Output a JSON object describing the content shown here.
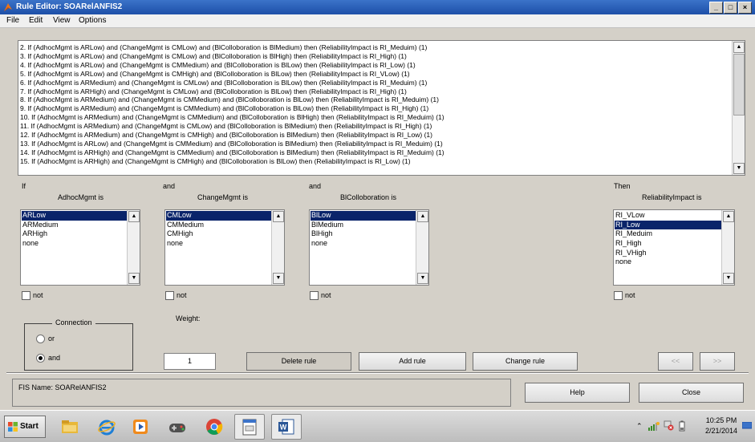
{
  "window": {
    "title": "Rule Editor: SOARelANFIS2"
  },
  "menu": [
    "File",
    "Edit",
    "View",
    "Options"
  ],
  "rules": [
    "2. If (AdhocMgmt is ARLow) and (ChangeMgmt is CMLow) and (BlColloboration is BlMedium) then (ReliabilityImpact is RI_Meduim) (1)",
    "3. If (AdhocMgmt is ARLow) and (ChangeMgmt is CMLow) and (BlColloboration is BlHigh) then (ReliabilityImpact is RI_High) (1)",
    "4. If (AdhocMgmt is ARLow) and (ChangeMgmt is CMMedium) and (BlColloboration is BlLow) then (ReliabilityImpact is RI_Low) (1)",
    "5. If (AdhocMgmt is ARLow) and (ChangeMgmt is CMHigh) and (BlColloboration is BlLow) then (ReliabilityImpact is RI_VLow) (1)",
    "6. If (AdhocMgmt is ARMedium) and (ChangeMgmt is CMLow) and (BlColloboration is BlLow) then (ReliabilityImpact is RI_Meduim) (1)",
    "7. If (AdhocMgmt is ARHigh) and (ChangeMgmt is CMLow) and (BlColloboration is BlLow) then (ReliabilityImpact is RI_High) (1)",
    "8. If (AdhocMgmt is ARMedium) and (ChangeMgmt is CMMedium) and (BlColloboration is BlLow) then (ReliabilityImpact is RI_Meduim) (1)",
    "9. If (AdhocMgmt is ARMedium) and (ChangeMgmt is CMMedium) and (BlColloboration is BlLow) then (ReliabilityImpact is RI_High) (1)",
    "10. If (AdhocMgmt is ARMedium) and (ChangeMgmt is CMMedium) and (BlColloboration is BlHigh) then (ReliabilityImpact is RI_Meduim) (1)",
    "11. If (AdhocMgmt is ARMedium) and (ChangeMgmt is CMLow) and (BlColloboration is BlMedium) then (ReliabilityImpact is RI_High) (1)",
    "12. If (AdhocMgmt is ARMedium) and (ChangeMgmt is CMHigh) and (BlColloboration is BlMedium) then (ReliabilityImpact is RI_Low) (1)",
    "13. If (AdhocMgmt is ARLow) and (ChangeMgmt is CMMedium) and (BlColloboration is BlMedium) then (ReliabilityImpact is RI_Meduim) (1)",
    "14. If (AdhocMgmt is ARHigh) and (ChangeMgmt is CMMedium) and (BlColloboration is BlMedium) then (ReliabilityImpact is RI_Meduim) (1)",
    "15. If (AdhocMgmt is ARHigh) and (ChangeMgmt is CMHigh) and (BlColloboration is BlLow) then (ReliabilityImpact is RI_Low) (1)"
  ],
  "inputs": [
    {
      "connector": "If",
      "name": "AdhocMgmt is",
      "options": [
        "ARLow",
        "ARMedium",
        "ARHigh",
        "none"
      ],
      "selected": 0,
      "not_label": "not"
    },
    {
      "connector": "and",
      "name": "ChangeMgmt is",
      "options": [
        "CMLow",
        "CMMedium",
        "CMHigh",
        "none"
      ],
      "selected": 0,
      "not_label": "not"
    },
    {
      "connector": "and",
      "name": "BlColloboration is",
      "options": [
        "BlLow",
        "BlMedium",
        "BlHigh",
        "none"
      ],
      "selected": 0,
      "not_label": "not"
    }
  ],
  "output": {
    "connector": "Then",
    "name": "ReliabilityImpact is",
    "options": [
      "RI_VLow",
      "RI_Low",
      "RI_Meduim",
      "RI_High",
      "RI_VHigh",
      "none"
    ],
    "selected": 1,
    "not_label": "not"
  },
  "connection": {
    "title": "Connection",
    "or_label": "or",
    "and_label": "and",
    "selected": "and"
  },
  "weight": {
    "label": "Weight:",
    "value": "1"
  },
  "buttons": {
    "delete": "Delete rule",
    "add": "Add rule",
    "change": "Change rule",
    "prev": "<<",
    "next": ">>",
    "help": "Help",
    "close": "Close"
  },
  "status": {
    "fis_name": "FIS Name: SOARelANFIS2"
  },
  "taskbar": {
    "start": "Start",
    "time": "10:25 PM",
    "date": "2/21/2014"
  }
}
